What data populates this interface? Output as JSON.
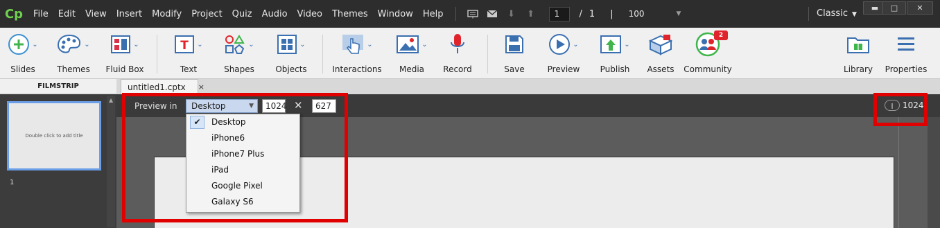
{
  "app": {
    "logo_text": "Cp"
  },
  "menubar": {
    "items": [
      "File",
      "Edit",
      "View",
      "Insert",
      "Modify",
      "Project",
      "Quiz",
      "Audio",
      "Video",
      "Themes",
      "Window",
      "Help"
    ],
    "icons": [
      "presentation-icon",
      "mail-icon",
      "arrow-down-icon",
      "arrow-up-icon"
    ],
    "current_page": "1",
    "page_separator": "/",
    "total_pages": "1",
    "zoom_separator": "|",
    "zoom": "100",
    "workspace": "Classic"
  },
  "toolbar": {
    "slides": "Slides",
    "themes": "Themes",
    "fluid_box": "Fluid Box",
    "text": "Text",
    "shapes": "Shapes",
    "objects": "Objects",
    "interactions": "Interactions",
    "media": "Media",
    "record": "Record",
    "save": "Save",
    "preview": "Preview",
    "publish": "Publish",
    "assets": "Assets",
    "community": "Community",
    "community_badge": "2",
    "library": "Library",
    "properties": "Properties"
  },
  "filmstrip": {
    "title": "FILMSTRIP",
    "thumb_text": "Double click to add title",
    "slide_number": "1"
  },
  "document": {
    "tab_label": "untitled1.cptx",
    "tab_close": "×"
  },
  "preview": {
    "label": "Preview in",
    "device": "Desktop",
    "width": "1024",
    "height": "627",
    "times": "✕",
    "current_width": "1024",
    "options": [
      "Desktop",
      "iPhone6",
      "iPhone7 Plus",
      "iPad",
      "Google Pixel",
      "Galaxy S6"
    ],
    "selected_index": 0
  },
  "colors": {
    "highlight": "#e00000",
    "accent_blue": "#3a6fb0",
    "badge_red": "#e0242b"
  }
}
